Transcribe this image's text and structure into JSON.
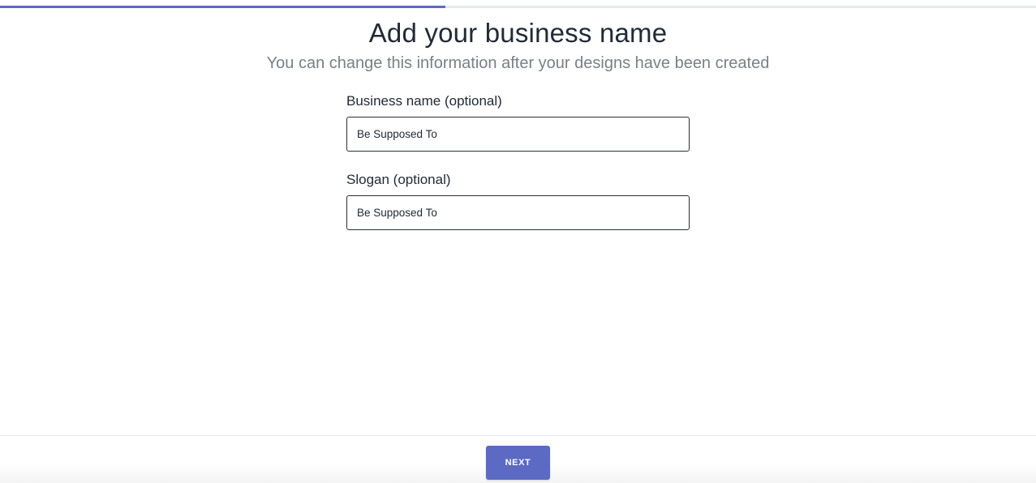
{
  "progress": {
    "fraction": 0.43,
    "track_color": "#e7e8ee",
    "fill_color": "#5c6ac4"
  },
  "header": {
    "title": "Add your business name",
    "subtitle": "You can change this information after your designs have been created"
  },
  "form": {
    "business_name": {
      "label": "Business name (optional)",
      "value": "Be Supposed To"
    },
    "slogan": {
      "label": "Slogan (optional)",
      "value": "Be Supposed To"
    }
  },
  "footer": {
    "next_label": "NEXT",
    "accent": "#5c6ac4"
  }
}
